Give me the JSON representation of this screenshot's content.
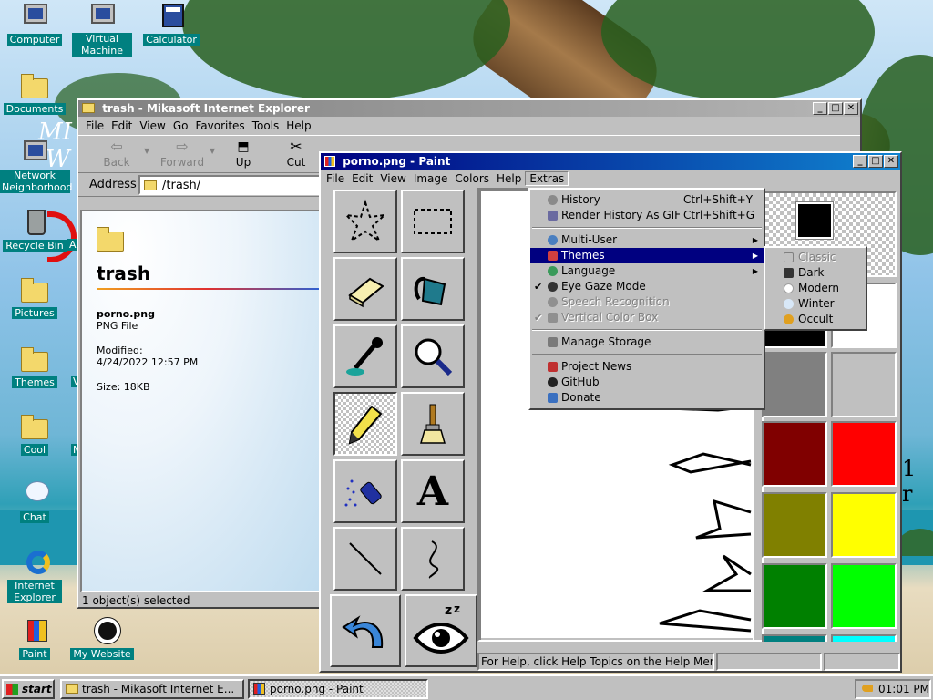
{
  "desktop": {
    "icons": [
      {
        "label": "Computer",
        "icon": "computer-icon"
      },
      {
        "label": "Virtual Machine",
        "icon": "virtual-machine-icon"
      },
      {
        "label": "Calculator",
        "icon": "calculator-icon"
      },
      {
        "label": "Documents",
        "icon": "folder-icon"
      },
      {
        "label": "Network Neighborhood",
        "icon": "network-icon"
      },
      {
        "label": "Recycle Bin",
        "icon": "recycle-bin-icon"
      },
      {
        "label": "Pictures",
        "icon": "folder-icon"
      },
      {
        "label": "Themes",
        "icon": "folder-icon"
      },
      {
        "label": "Cool",
        "icon": "folder-icon"
      },
      {
        "label": "Chat",
        "icon": "chat-icon"
      },
      {
        "label": "Internet Explorer",
        "icon": "internet-explorer-icon"
      },
      {
        "label": "Paint",
        "icon": "paint-icon"
      },
      {
        "label": "My Website",
        "icon": "github-icon"
      }
    ],
    "partial_labels": {
      "right_of_recycle": "A",
      "right_of_themes": "V",
      "right_of_cool": "M"
    }
  },
  "explorer": {
    "title": "trash - Mikasoft Internet Explorer",
    "menu": [
      "File",
      "Edit",
      "View",
      "Go",
      "Favorites",
      "Tools",
      "Help"
    ],
    "toolbar": {
      "back": "Back",
      "forward": "Forward",
      "up": "Up",
      "cut": "Cut"
    },
    "address_label": "Address",
    "address_value": "/trash/",
    "folder_name": "trash",
    "file_name": "porno.png",
    "file_type": "PNG File",
    "modified_label": "Modified:",
    "modified_value": "4/24/2022 12:57 PM",
    "size": "Size: 18KB",
    "status": "1 object(s) selected"
  },
  "paint": {
    "title": "porno.png - Paint",
    "menu": [
      "File",
      "Edit",
      "View",
      "Image",
      "Colors",
      "Help",
      "Extras"
    ],
    "status": "For Help, click Help Topics on the Help Menu.",
    "tools": [
      "free-form-select",
      "rectangle-select",
      "eraser",
      "fill-bucket",
      "color-picker",
      "magnifier",
      "pencil",
      "brush",
      "airbrush",
      "text",
      "line",
      "curve",
      "undo",
      "eye-gaze"
    ],
    "text_tool_glyph": "A",
    "palette": {
      "primary": "#000000",
      "secondary": "#ffffff",
      "colors": [
        "#000000",
        "#ffffff",
        "#808080",
        "#c0c0c0",
        "#800000",
        "#ff0000",
        "#808000",
        "#ffff00",
        "#008000",
        "#00ff00",
        "#008080",
        "#00ffff"
      ]
    }
  },
  "extras_menu": {
    "items": [
      {
        "label": "History",
        "shortcut": "Ctrl+Shift+Y",
        "icon": "history-icon",
        "color": "#8a8a8a"
      },
      {
        "label": "Render History As GIF",
        "shortcut": "Ctrl+Shift+G",
        "icon": "film-icon",
        "color": "#6a6aa0"
      },
      {
        "label": "Multi-User",
        "arrow": "▶",
        "icon": "users-icon",
        "color": "#4a7fc0"
      },
      {
        "label": "Themes",
        "arrow": "▶",
        "icon": "themes-icon",
        "color": "#d04040"
      },
      {
        "label": "Language",
        "arrow": "▶",
        "icon": "language-icon",
        "color": "#3a9a5a"
      },
      {
        "label": "Eye Gaze Mode",
        "check": "✔",
        "icon": "eye-icon",
        "color": "#333333"
      },
      {
        "label": "Speech Recognition",
        "icon": "microphone-icon",
        "color": "#909090"
      },
      {
        "label": "Vertical Color Box",
        "check": "✔",
        "icon": "palette-icon",
        "color": "#909090"
      },
      {
        "label": "Manage Storage",
        "icon": "storage-icon",
        "color": "#7a7a7a"
      },
      {
        "label": "Project News",
        "icon": "news-icon",
        "color": "#c03030"
      },
      {
        "label": "GitHub",
        "icon": "github-icon",
        "color": "#222222"
      },
      {
        "label": "Donate",
        "icon": "donate-icon",
        "color": "#3a70c0"
      }
    ]
  },
  "themes_submenu": {
    "items": [
      {
        "label": "Classic",
        "icon": "classic-theme-icon",
        "color": "#c0c0c0"
      },
      {
        "label": "Dark",
        "icon": "dark-theme-icon",
        "color": "#333333"
      },
      {
        "label": "Modern",
        "icon": "modern-theme-icon",
        "color": "#ffffff"
      },
      {
        "label": "Winter",
        "icon": "winter-theme-icon",
        "color": "#d8e8f8"
      },
      {
        "label": "Occult",
        "icon": "occult-theme-icon",
        "color": "#e0a020"
      }
    ]
  },
  "taskbar": {
    "start": "start",
    "tasks": [
      "trash - Mikasoft Internet E...",
      "porno.png - Paint"
    ],
    "clock": "01:01 PM"
  },
  "wallpaper_text": {
    "left1": "MI",
    "left2": "W",
    "right": "1 r"
  }
}
